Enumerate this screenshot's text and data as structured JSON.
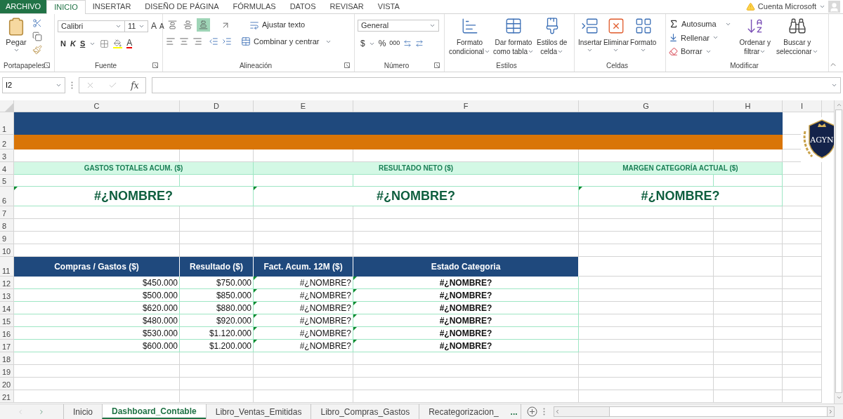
{
  "ribbon_tabs": [
    {
      "label": "ARCHIVO",
      "kind": "file",
      "selected": false
    },
    {
      "label": "INICIO",
      "kind": "tab",
      "selected": true
    },
    {
      "label": "INSERTAR",
      "kind": "tab",
      "selected": false
    },
    {
      "label": "DISEÑO DE PÁGINA",
      "kind": "tab",
      "selected": false
    },
    {
      "label": "FÓRMULAS",
      "kind": "tab",
      "selected": false
    },
    {
      "label": "DATOS",
      "kind": "tab",
      "selected": false
    },
    {
      "label": "REVISAR",
      "kind": "tab",
      "selected": false
    },
    {
      "label": "VISTA",
      "kind": "tab",
      "selected": false
    }
  ],
  "account": {
    "label": "Cuenta Microsoft"
  },
  "clipboard": {
    "paste": "Pegar",
    "group": "Portapapeles"
  },
  "font": {
    "name": "Calibri",
    "size": "11",
    "grow": "A",
    "shrink": "A",
    "bold": "N",
    "italic": "K",
    "underline": "S",
    "font_color": "A",
    "group": "Fuente"
  },
  "alignment": {
    "vertical": [
      {
        "selected": false
      },
      {
        "selected": false
      },
      {
        "selected": true
      }
    ],
    "wrap": "Ajustar texto",
    "merge": "Combinar y centrar",
    "group": "Alineación"
  },
  "number": {
    "format": "General",
    "currency": "$",
    "percent": "%",
    "thousands": "000",
    "group": "Número"
  },
  "styles": {
    "buttons": [
      {
        "line1": "Formato",
        "line2": "condicional"
      },
      {
        "line1": "Dar formato",
        "line2": "como tabla"
      },
      {
        "line1": "Estilos de",
        "line2": "celda"
      }
    ],
    "group": "Estilos"
  },
  "cells": {
    "buttons": [
      {
        "label": "Insertar"
      },
      {
        "label": "Eliminar"
      },
      {
        "label": "Formato"
      }
    ],
    "group": "Celdas"
  },
  "editing": {
    "autosum": "Autosuma",
    "fill": "Rellenar",
    "clear": "Borrar",
    "sort": {
      "line1": "Ordenar y",
      "line2": "filtrar"
    },
    "find": {
      "line1": "Buscar y",
      "line2": "seleccionar"
    },
    "group": "Modificar"
  },
  "formula_bar": {
    "name_box": "I2",
    "fx": "fx"
  },
  "columns": [
    "C",
    "D",
    "E",
    "F",
    "G",
    "H",
    "I"
  ],
  "rows": [
    "1",
    "2",
    "3",
    "4",
    "5",
    "6",
    "7",
    "8",
    "9",
    "10",
    "11",
    "12",
    "13",
    "14",
    "15",
    "16",
    "17",
    "18",
    "19",
    "20",
    "21"
  ],
  "logo": {
    "text": "AGYN"
  },
  "kpis": [
    {
      "label": "GASTOS TOTALES ACUM. ($)",
      "value": "#¿NOMBRE?"
    },
    {
      "label": "RESULTADO NETO ($)",
      "value": "#¿NOMBRE?"
    },
    {
      "label": "MARGEN CATEGORÍA ACTUAL ($)",
      "value": "#¿NOMBRE?"
    }
  ],
  "table": {
    "columns": [
      "Compras / Gastos ($)",
      "Resultado ($)",
      "Fact. Acum. 12M ($)",
      "Estado Categoria"
    ],
    "rows": [
      [
        "$450.000",
        "$750.000",
        "#¿NOMBRE?",
        "#¿NOMBRE?"
      ],
      [
        "$500.000",
        "$850.000",
        "#¿NOMBRE?",
        "#¿NOMBRE?"
      ],
      [
        "$620.000",
        "$880.000",
        "#¿NOMBRE?",
        "#¿NOMBRE?"
      ],
      [
        "$480.000",
        "$920.000",
        "#¿NOMBRE?",
        "#¿NOMBRE?"
      ],
      [
        "$530.000",
        "$1.120.000",
        "#¿NOMBRE?",
        "#¿NOMBRE?"
      ],
      [
        "$600.000",
        "$1.200.000",
        "#¿NOMBRE?",
        "#¿NOMBRE?"
      ]
    ]
  },
  "sheet_tabs": [
    {
      "label": "Inicio",
      "selected": false
    },
    {
      "label": "Dashboard_Contable",
      "selected": true
    },
    {
      "label": "Libro_Ventas_Emitidas",
      "selected": false
    },
    {
      "label": "Libro_Compras_Gastos",
      "selected": false
    },
    {
      "label": "Recategorizacion_",
      "selected": false
    }
  ],
  "sheet_tabs_more": "..."
}
